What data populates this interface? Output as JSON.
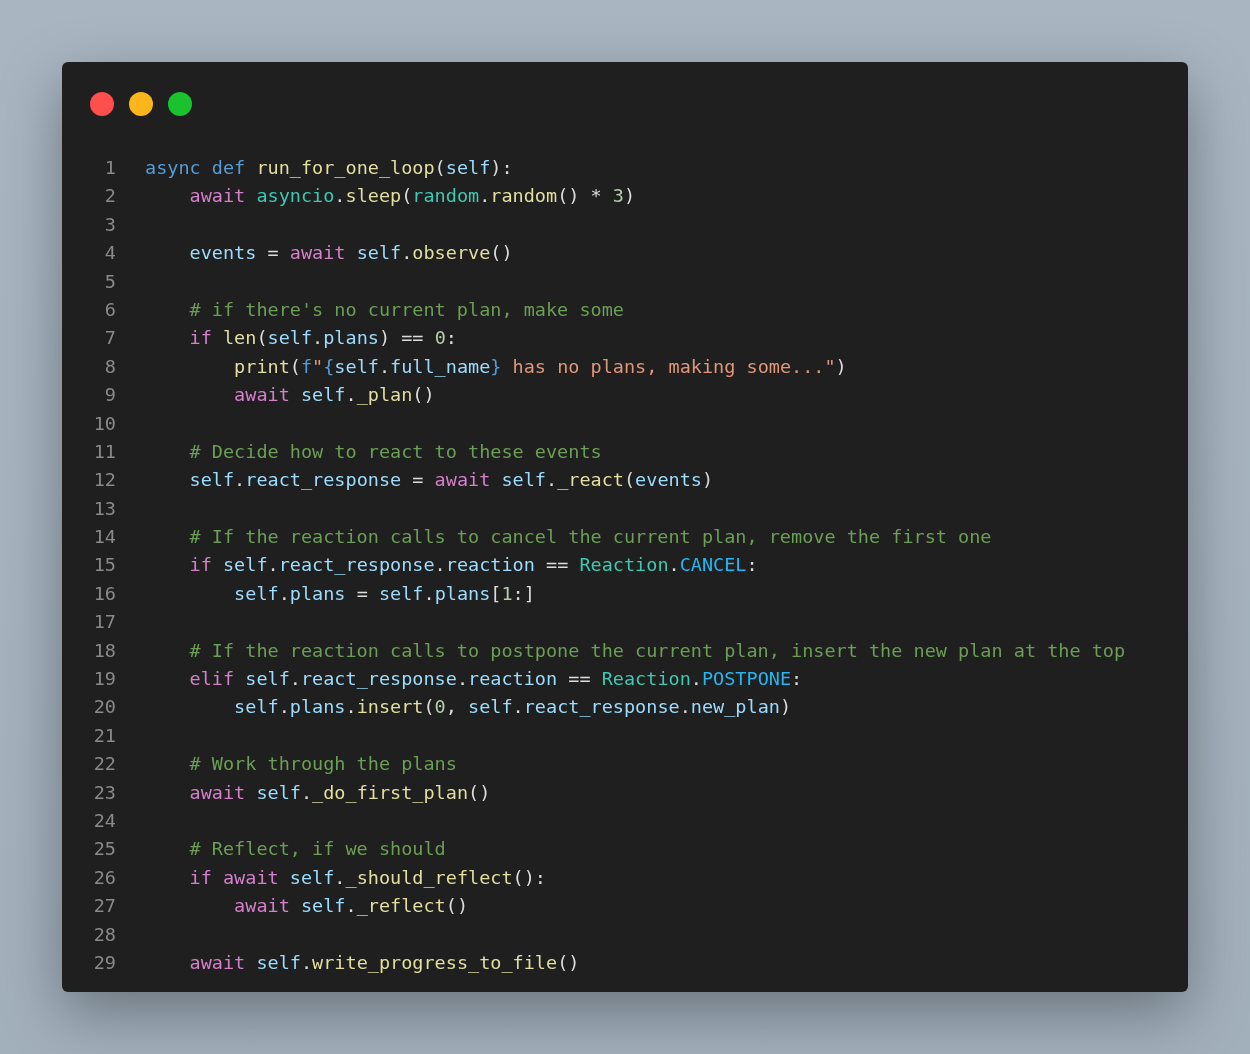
{
  "code": {
    "lines": [
      {
        "number": "1",
        "tokens": [
          {
            "kind": "decl",
            "text": "async def "
          },
          {
            "kind": "function",
            "text": "run_for_one_loop"
          },
          {
            "kind": "plain",
            "text": "("
          },
          {
            "kind": "variable",
            "text": "self"
          },
          {
            "kind": "plain",
            "text": "):"
          }
        ]
      },
      {
        "number": "2",
        "tokens": [
          {
            "kind": "keyword",
            "text": "    await "
          },
          {
            "kind": "type",
            "text": "asyncio"
          },
          {
            "kind": "plain",
            "text": "."
          },
          {
            "kind": "function",
            "text": "sleep"
          },
          {
            "kind": "plain",
            "text": "("
          },
          {
            "kind": "type",
            "text": "random"
          },
          {
            "kind": "plain",
            "text": "."
          },
          {
            "kind": "function",
            "text": "random"
          },
          {
            "kind": "plain",
            "text": "() * "
          },
          {
            "kind": "number",
            "text": "3"
          },
          {
            "kind": "plain",
            "text": ")"
          }
        ]
      },
      {
        "number": "3"
      },
      {
        "number": "4",
        "tokens": [
          {
            "kind": "variable",
            "text": "    events"
          },
          {
            "kind": "plain",
            "text": " = "
          },
          {
            "kind": "keyword",
            "text": "await "
          },
          {
            "kind": "variable",
            "text": "self"
          },
          {
            "kind": "plain",
            "text": "."
          },
          {
            "kind": "function",
            "text": "observe"
          },
          {
            "kind": "plain",
            "text": "()"
          }
        ]
      },
      {
        "number": "5"
      },
      {
        "number": "6",
        "tokens": [
          {
            "kind": "comment",
            "text": "    # if there's no current plan, make some"
          }
        ]
      },
      {
        "number": "7",
        "tokens": [
          {
            "kind": "keyword",
            "text": "    if "
          },
          {
            "kind": "function",
            "text": "len"
          },
          {
            "kind": "plain",
            "text": "("
          },
          {
            "kind": "variable",
            "text": "self"
          },
          {
            "kind": "plain",
            "text": "."
          },
          {
            "kind": "variable",
            "text": "plans"
          },
          {
            "kind": "plain",
            "text": ") == "
          },
          {
            "kind": "number",
            "text": "0"
          },
          {
            "kind": "plain",
            "text": ":"
          }
        ]
      },
      {
        "number": "8",
        "tokens": [
          {
            "kind": "function",
            "text": "        print"
          },
          {
            "kind": "plain",
            "text": "("
          },
          {
            "kind": "decl",
            "text": "f"
          },
          {
            "kind": "string",
            "text": "\""
          },
          {
            "kind": "decl",
            "text": "{"
          },
          {
            "kind": "variable",
            "text": "self"
          },
          {
            "kind": "plain",
            "text": "."
          },
          {
            "kind": "variable",
            "text": "full_name"
          },
          {
            "kind": "decl",
            "text": "}"
          },
          {
            "kind": "string",
            "text": " has no plans, making some...\""
          },
          {
            "kind": "plain",
            "text": ")"
          }
        ]
      },
      {
        "number": "9",
        "tokens": [
          {
            "kind": "keyword",
            "text": "        await "
          },
          {
            "kind": "variable",
            "text": "self"
          },
          {
            "kind": "plain",
            "text": "."
          },
          {
            "kind": "function",
            "text": "_plan"
          },
          {
            "kind": "plain",
            "text": "()"
          }
        ]
      },
      {
        "number": "10"
      },
      {
        "number": "11",
        "tokens": [
          {
            "kind": "comment",
            "text": "    # Decide how to react to these events"
          }
        ]
      },
      {
        "number": "12",
        "tokens": [
          {
            "kind": "variable",
            "text": "    self"
          },
          {
            "kind": "plain",
            "text": "."
          },
          {
            "kind": "variable",
            "text": "react_response"
          },
          {
            "kind": "plain",
            "text": " = "
          },
          {
            "kind": "keyword",
            "text": "await "
          },
          {
            "kind": "variable",
            "text": "self"
          },
          {
            "kind": "plain",
            "text": "."
          },
          {
            "kind": "function",
            "text": "_react"
          },
          {
            "kind": "plain",
            "text": "("
          },
          {
            "kind": "variable",
            "text": "events"
          },
          {
            "kind": "plain",
            "text": ")"
          }
        ]
      },
      {
        "number": "13"
      },
      {
        "number": "14",
        "tokens": [
          {
            "kind": "comment",
            "text": "    # If the reaction calls to cancel the current plan, remove the first one"
          }
        ]
      },
      {
        "number": "15",
        "tokens": [
          {
            "kind": "keyword",
            "text": "    if "
          },
          {
            "kind": "variable",
            "text": "self"
          },
          {
            "kind": "plain",
            "text": "."
          },
          {
            "kind": "variable",
            "text": "react_response"
          },
          {
            "kind": "plain",
            "text": "."
          },
          {
            "kind": "variable",
            "text": "reaction"
          },
          {
            "kind": "plain",
            "text": " == "
          },
          {
            "kind": "type",
            "text": "Reaction"
          },
          {
            "kind": "plain",
            "text": "."
          },
          {
            "kind": "constant",
            "text": "CANCEL"
          },
          {
            "kind": "plain",
            "text": ":"
          }
        ]
      },
      {
        "number": "16",
        "tokens": [
          {
            "kind": "variable",
            "text": "        self"
          },
          {
            "kind": "plain",
            "text": "."
          },
          {
            "kind": "variable",
            "text": "plans"
          },
          {
            "kind": "plain",
            "text": " = "
          },
          {
            "kind": "variable",
            "text": "self"
          },
          {
            "kind": "plain",
            "text": "."
          },
          {
            "kind": "variable",
            "text": "plans"
          },
          {
            "kind": "plain",
            "text": "["
          },
          {
            "kind": "number",
            "text": "1"
          },
          {
            "kind": "plain",
            "text": ":]"
          }
        ]
      },
      {
        "number": "17"
      },
      {
        "number": "18",
        "tokens": [
          {
            "kind": "comment",
            "text": "    # If the reaction calls to postpone the current plan, insert the new plan at the top"
          }
        ]
      },
      {
        "number": "19",
        "tokens": [
          {
            "kind": "keyword",
            "text": "    elif "
          },
          {
            "kind": "variable",
            "text": "self"
          },
          {
            "kind": "plain",
            "text": "."
          },
          {
            "kind": "variable",
            "text": "react_response"
          },
          {
            "kind": "plain",
            "text": "."
          },
          {
            "kind": "variable",
            "text": "reaction"
          },
          {
            "kind": "plain",
            "text": " == "
          },
          {
            "kind": "type",
            "text": "Reaction"
          },
          {
            "kind": "plain",
            "text": "."
          },
          {
            "kind": "constant",
            "text": "POSTPONE"
          },
          {
            "kind": "plain",
            "text": ":"
          }
        ]
      },
      {
        "number": "20",
        "tokens": [
          {
            "kind": "variable",
            "text": "        self"
          },
          {
            "kind": "plain",
            "text": "."
          },
          {
            "kind": "variable",
            "text": "plans"
          },
          {
            "kind": "plain",
            "text": "."
          },
          {
            "kind": "function",
            "text": "insert"
          },
          {
            "kind": "plain",
            "text": "("
          },
          {
            "kind": "number",
            "text": "0"
          },
          {
            "kind": "plain",
            "text": ", "
          },
          {
            "kind": "variable",
            "text": "self"
          },
          {
            "kind": "plain",
            "text": "."
          },
          {
            "kind": "variable",
            "text": "react_response"
          },
          {
            "kind": "plain",
            "text": "."
          },
          {
            "kind": "variable",
            "text": "new_plan"
          },
          {
            "kind": "plain",
            "text": ")"
          }
        ]
      },
      {
        "number": "21"
      },
      {
        "number": "22",
        "tokens": [
          {
            "kind": "comment",
            "text": "    # Work through the plans"
          }
        ]
      },
      {
        "number": "23",
        "tokens": [
          {
            "kind": "keyword",
            "text": "    await "
          },
          {
            "kind": "variable",
            "text": "self"
          },
          {
            "kind": "plain",
            "text": "."
          },
          {
            "kind": "function",
            "text": "_do_first_plan"
          },
          {
            "kind": "plain",
            "text": "()"
          }
        ]
      },
      {
        "number": "24"
      },
      {
        "number": "25",
        "tokens": [
          {
            "kind": "comment",
            "text": "    # Reflect, if we should"
          }
        ]
      },
      {
        "number": "26",
        "tokens": [
          {
            "kind": "keyword",
            "text": "    if await "
          },
          {
            "kind": "variable",
            "text": "self"
          },
          {
            "kind": "plain",
            "text": "."
          },
          {
            "kind": "function",
            "text": "_should_reflect"
          },
          {
            "kind": "plain",
            "text": "():"
          }
        ]
      },
      {
        "number": "27",
        "tokens": [
          {
            "kind": "keyword",
            "text": "        await "
          },
          {
            "kind": "variable",
            "text": "self"
          },
          {
            "kind": "plain",
            "text": "."
          },
          {
            "kind": "function",
            "text": "_reflect"
          },
          {
            "kind": "plain",
            "text": "()"
          }
        ]
      },
      {
        "number": "28"
      },
      {
        "number": "29",
        "tokens": [
          {
            "kind": "keyword",
            "text": "    await "
          },
          {
            "kind": "variable",
            "text": "self"
          },
          {
            "kind": "plain",
            "text": "."
          },
          {
            "kind": "function",
            "text": "write_progress_to_file"
          },
          {
            "kind": "plain",
            "text": "()"
          }
        ]
      }
    ]
  }
}
